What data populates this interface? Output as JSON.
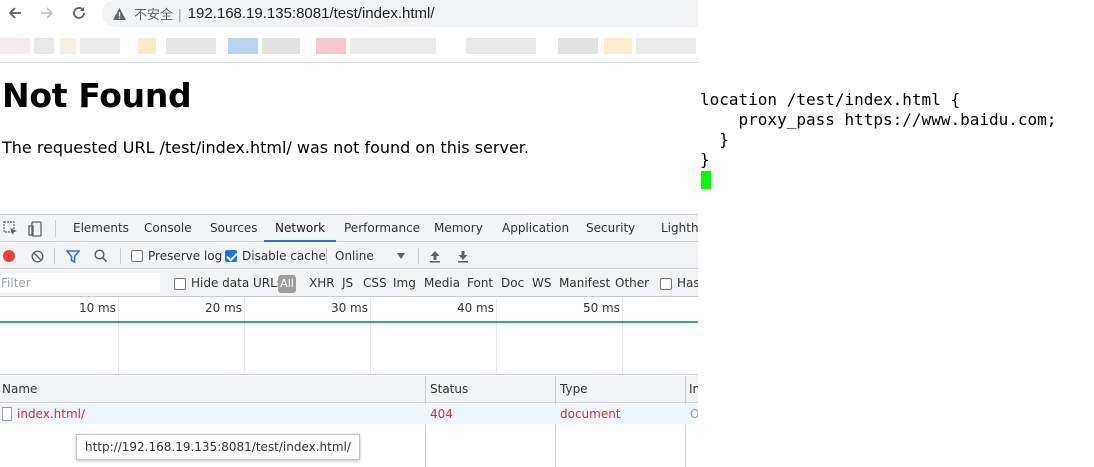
{
  "browser": {
    "back_icon": "arrow-left-icon",
    "forward_icon": "arrow-right-icon",
    "reload_icon": "reload-icon",
    "security_icon": "warning-triangle-icon",
    "security_label": "不安全",
    "address_separator": "|",
    "url": "192.168.19.135:8081/test/index.html/"
  },
  "page": {
    "heading": "Not Found",
    "message": "The requested URL /test/index.html/ was not found on this server."
  },
  "devtools": {
    "tabs": [
      {
        "label": "Elements"
      },
      {
        "label": "Console"
      },
      {
        "label": "Sources"
      },
      {
        "label": "Network",
        "active": true
      },
      {
        "label": "Performance"
      },
      {
        "label": "Memory"
      },
      {
        "label": "Application"
      },
      {
        "label": "Security"
      },
      {
        "label": "Lightho"
      }
    ],
    "controls": {
      "preserve_log": {
        "label": "Preserve log",
        "checked": false
      },
      "disable_cache": {
        "label": "Disable cache",
        "checked": true
      },
      "throttling": "Online"
    },
    "filter": {
      "placeholder": "Filter",
      "hide_data_urls": "Hide data URLs",
      "all": "All",
      "types": [
        "XHR",
        "JS",
        "CSS",
        "Img",
        "Media",
        "Font",
        "Doc",
        "WS",
        "Manifest",
        "Other"
      ],
      "has_blocked": "Has"
    },
    "timeline": {
      "ticks": [
        "10 ms",
        "20 ms",
        "30 ms",
        "40 ms",
        "50 ms"
      ]
    },
    "table": {
      "columns": [
        "Name",
        "Status",
        "Type",
        "In"
      ],
      "rows": [
        {
          "name": "index.html/",
          "status": "404",
          "type": "document",
          "initiator": "O"
        }
      ]
    },
    "tooltip": "http://192.168.19.135:8081/test/index.html/"
  },
  "config": {
    "lines": [
      "location /test/index.html {",
      "    proxy_pass https://www.baidu.com;",
      "  }",
      "}"
    ],
    "cursor_color": "#00ff00"
  },
  "colors": {
    "accent": "#1a73e8",
    "error": "#d93025",
    "timeline": "#2db36b"
  }
}
